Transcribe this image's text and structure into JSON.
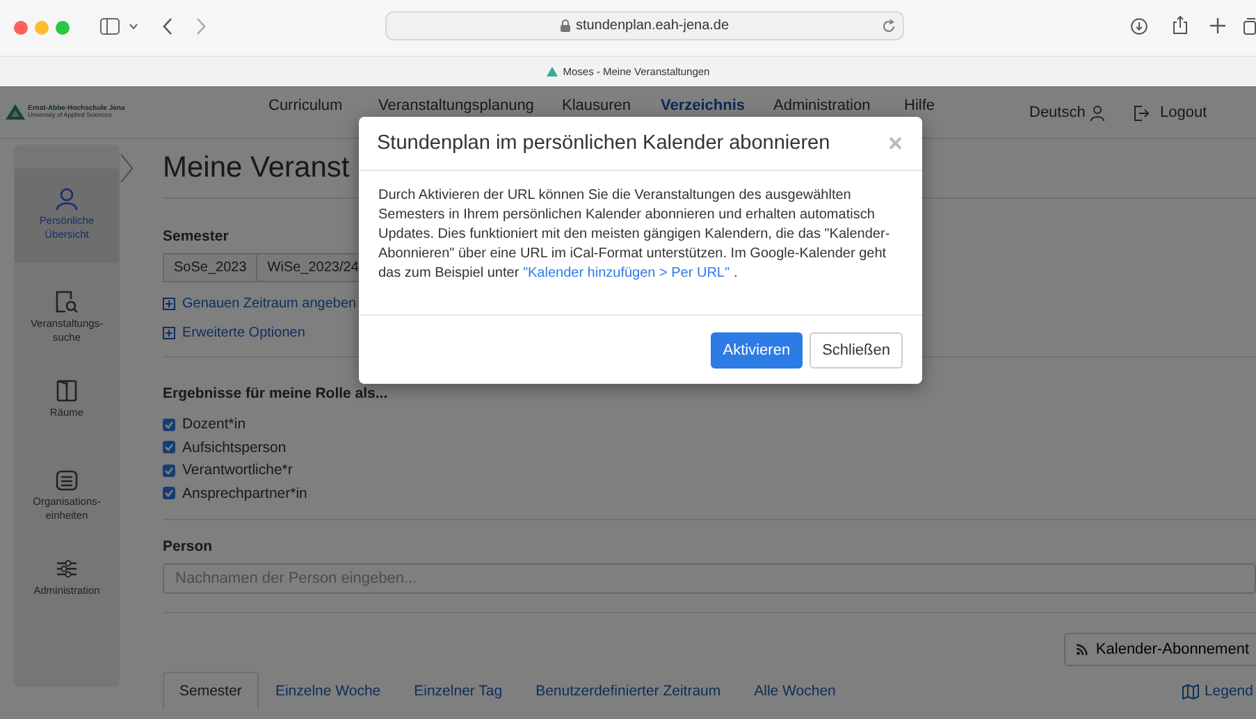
{
  "browser": {
    "url": "stundenplan.eah-jena.de",
    "tab_title": "Moses - Meine Veranstaltungen"
  },
  "header": {
    "logo_name": "Ernst-Abbe-Hochschule Jena",
    "logo_subtitle": "University of Applied Sciences",
    "nav": [
      {
        "label": "Curriculum",
        "selected": false
      },
      {
        "label": "Veranstaltungsplanung",
        "selected": false
      },
      {
        "label": "Klausuren",
        "selected": false
      },
      {
        "label": "Verzeichnis",
        "selected": true
      },
      {
        "label": "Administration",
        "selected": false
      },
      {
        "label": "Hilfe",
        "selected": false
      }
    ],
    "language": "Deutsch",
    "logout": "Logout"
  },
  "sidebar": {
    "items": [
      {
        "label": "Persönliche Übersicht",
        "selected": true
      },
      {
        "label": "Veranstaltungs-suche",
        "selected": false
      },
      {
        "label": "Räume",
        "selected": false
      },
      {
        "label": "Organisations-einheiten",
        "selected": false
      },
      {
        "label": "Administration",
        "selected": false
      }
    ]
  },
  "page": {
    "title": "Meine Veranst",
    "semester_label": "Semester",
    "semesters": [
      "SoSe_2023",
      "WiSe_2023/24"
    ],
    "links": [
      "Genauen Zeitraum angeben",
      "Erweiterte Optionen"
    ],
    "roles_label": "Ergebnisse für meine Rolle als...",
    "roles": [
      {
        "label": "Dozent*in",
        "checked": true
      },
      {
        "label": "Aufsichtsperson",
        "checked": true
      },
      {
        "label": "Verantwortliche*r",
        "checked": true
      },
      {
        "label": "Ansprechpartner*in",
        "checked": true
      }
    ],
    "person_label": "Person",
    "person_field": {
      "placeholder": "Nachnamen der Person eingeben..."
    },
    "subscription_button": "Kalender-Abonnement",
    "view_tabs": [
      {
        "label": "Semester",
        "selected": true
      },
      {
        "label": "Einzelne Woche",
        "selected": false
      },
      {
        "label": "Einzelner Tag",
        "selected": false
      },
      {
        "label": "Benutzerdefinierter Zeitraum",
        "selected": false
      },
      {
        "label": "Alle Wochen",
        "selected": false
      }
    ],
    "legend": "Legend"
  },
  "dialog": {
    "title": "Stundenplan im persönlichen Kalender abonnieren",
    "close": "×",
    "body": "Durch Aktivieren der URL können Sie die Veranstaltungen des ausgewählten Semesters in Ihrem persönlichen Kalender abonnieren und erhalten automatisch Updates. Dies funktioniert mit den meisten gängigen Kalendern, die das \"Kalender-Abonnieren\" über eine URL im iCal-Format unterstützen. Im Google-Kalender geht das zum Beispiel unter ",
    "link": "\"Kalender hinzufügen > Per URL\"",
    "body_end": ".",
    "buttons": [
      {
        "label": "Aktivieren",
        "kind": "primary"
      },
      {
        "label": "Schließen",
        "kind": "secondary"
      }
    ]
  }
}
